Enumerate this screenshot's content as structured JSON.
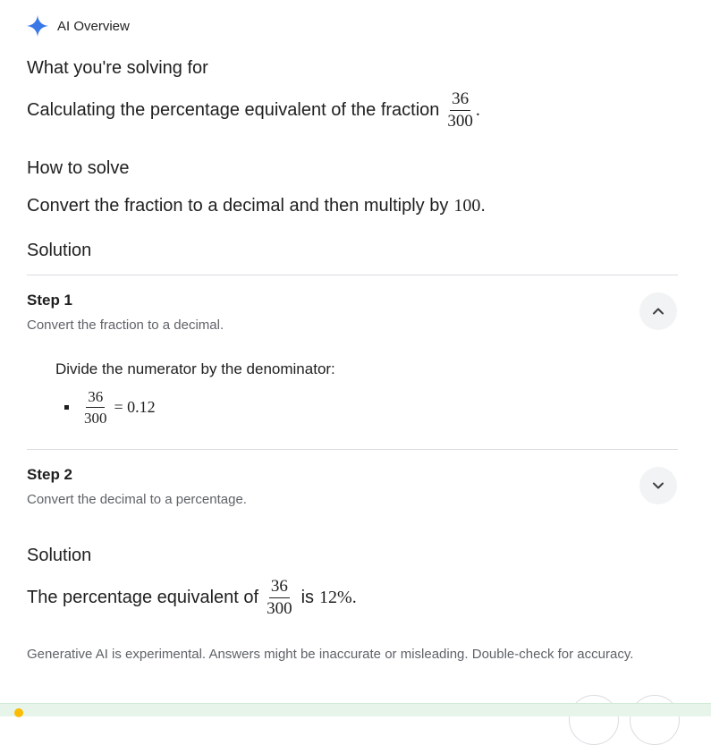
{
  "header": {
    "title": "AI Overview",
    "icon": "sparkle-icon",
    "accent": "#4285f4"
  },
  "sections": {
    "solving_for": {
      "heading": "What you're solving for",
      "text_before": "Calculating the percentage equivalent of the fraction",
      "fraction": {
        "num": "36",
        "den": "300"
      },
      "text_after": "."
    },
    "how_to": {
      "heading": "How to solve",
      "text_before": "Convert the fraction to a decimal and then multiply by",
      "math": "100",
      "text_after": "."
    },
    "solution_heading": "Solution"
  },
  "steps": [
    {
      "title": "Step 1",
      "subtitle": "Convert the fraction to a decimal.",
      "expanded": true,
      "toggle_icon": "chevron-up-icon",
      "body": "Divide the numerator by the denominator:",
      "bullet": {
        "fraction": {
          "num": "36",
          "den": "300"
        },
        "result": "= 0.12"
      }
    },
    {
      "title": "Step 2",
      "subtitle": "Convert the decimal to a percentage.",
      "expanded": false,
      "toggle_icon": "chevron-down-icon"
    }
  ],
  "final": {
    "heading": "Solution",
    "text_before": "The percentage equivalent of",
    "fraction": {
      "num": "36",
      "den": "300"
    },
    "text_mid": "is",
    "math": "12%",
    "text_after": "."
  },
  "disclaimer": "Generative AI is experimental. Answers might be inaccurate or misleading. Double-check for accuracy."
}
